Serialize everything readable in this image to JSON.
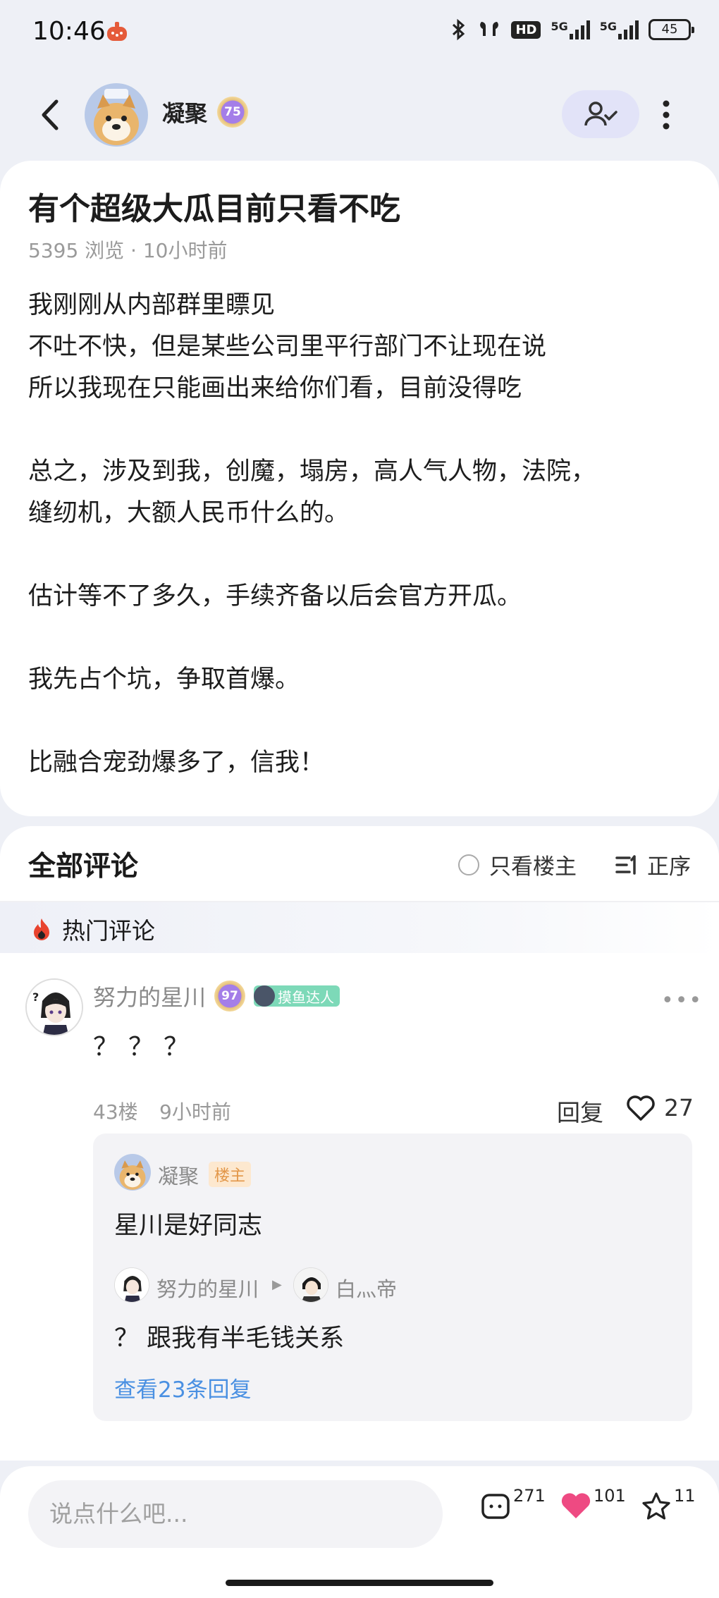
{
  "status_bar": {
    "time": "10:46",
    "hd": "HD",
    "net1": "5G",
    "net2": "5G",
    "battery": "45"
  },
  "header": {
    "author_name": "凝聚",
    "author_level": "75"
  },
  "post": {
    "title": "有个超级大瓜目前只看不吃",
    "meta": "5395 浏览 · 10小时前",
    "paragraphs": [
      "我刚刚从内部群里瞟见",
      "不吐不快，但是某些公司里平行部门不让现在说",
      "所以我现在只能画出来给你们看，目前没得吃",
      "",
      "总之，涉及到我，创魔，塌房，高人气人物，法院，",
      "缝纫机，大额人民币什么的。",
      "",
      "估计等不了多久，手续齐备以后会官方开瓜。",
      "",
      "我先占个坑，争取首爆。",
      "",
      "比融合宠劲爆多了，信我！"
    ]
  },
  "comments": {
    "title": "全部评论",
    "only_owner": "只看楼主",
    "sort_label": "正序",
    "hot_label": "热门评论",
    "items": [
      {
        "name": "努力的星川",
        "level": "97",
        "badge": "摸鱼达人",
        "text": "？？？",
        "floor": "43楼",
        "time": "9小时前",
        "reply_label": "回复",
        "likes": "27",
        "replies": [
          {
            "name": "凝聚",
            "tag": "楼主",
            "text": "星川是好同志"
          },
          {
            "name": "努力的星川",
            "to_name": "白灬帝",
            "text": "？ 跟我有半毛钱关系"
          }
        ],
        "view_more": "查看23条回复"
      }
    ]
  },
  "bottom_bar": {
    "input_placeholder": "说点什么吧...",
    "comment_count": "271",
    "like_count": "101",
    "fav_count": "11"
  },
  "colors": {
    "background": "#eef0f6",
    "accent_like": "#ee4a82",
    "link": "#4a90e2",
    "owner_tag_bg": "#fde8cf",
    "owner_tag_text": "#e29648",
    "badge_green": "#7dd9b8"
  },
  "icons": [
    "back-icon",
    "follow-check-icon",
    "more-icon",
    "flame-icon",
    "sort-icon",
    "heart-icon",
    "comment-icon",
    "star-icon"
  ]
}
